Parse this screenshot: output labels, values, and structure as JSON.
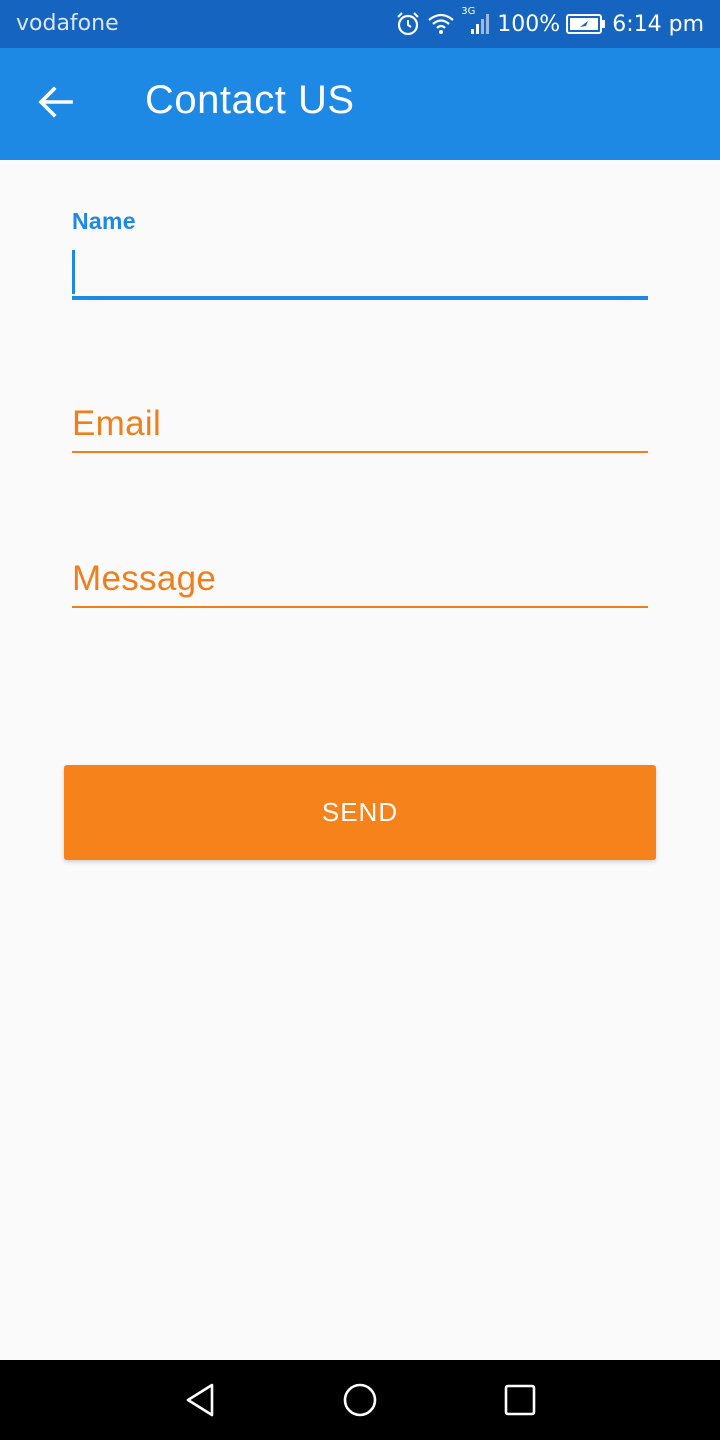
{
  "status_bar": {
    "carrier": "vodafone",
    "network": "3G",
    "battery": "100%",
    "time": "6:14 pm",
    "icons": [
      "alarm-icon",
      "wifi-icon",
      "signal-icon",
      "battery-icon"
    ]
  },
  "app_bar": {
    "title": "Contact US",
    "back_icon": "arrow-back-icon"
  },
  "form": {
    "name_label": "Name",
    "name_value": "",
    "email_label": "Email",
    "message_label": "Message",
    "send_label": "SEND"
  },
  "nav_bar": {
    "icons": [
      "back-triangle-icon",
      "home-circle-icon",
      "recents-square-icon"
    ]
  },
  "colors": {
    "status_bar": "#1565C0",
    "app_bar": "#1E88E5",
    "accent": "#F5821A",
    "label_orange": "#F07F1B",
    "background": "#FAFAFA"
  }
}
